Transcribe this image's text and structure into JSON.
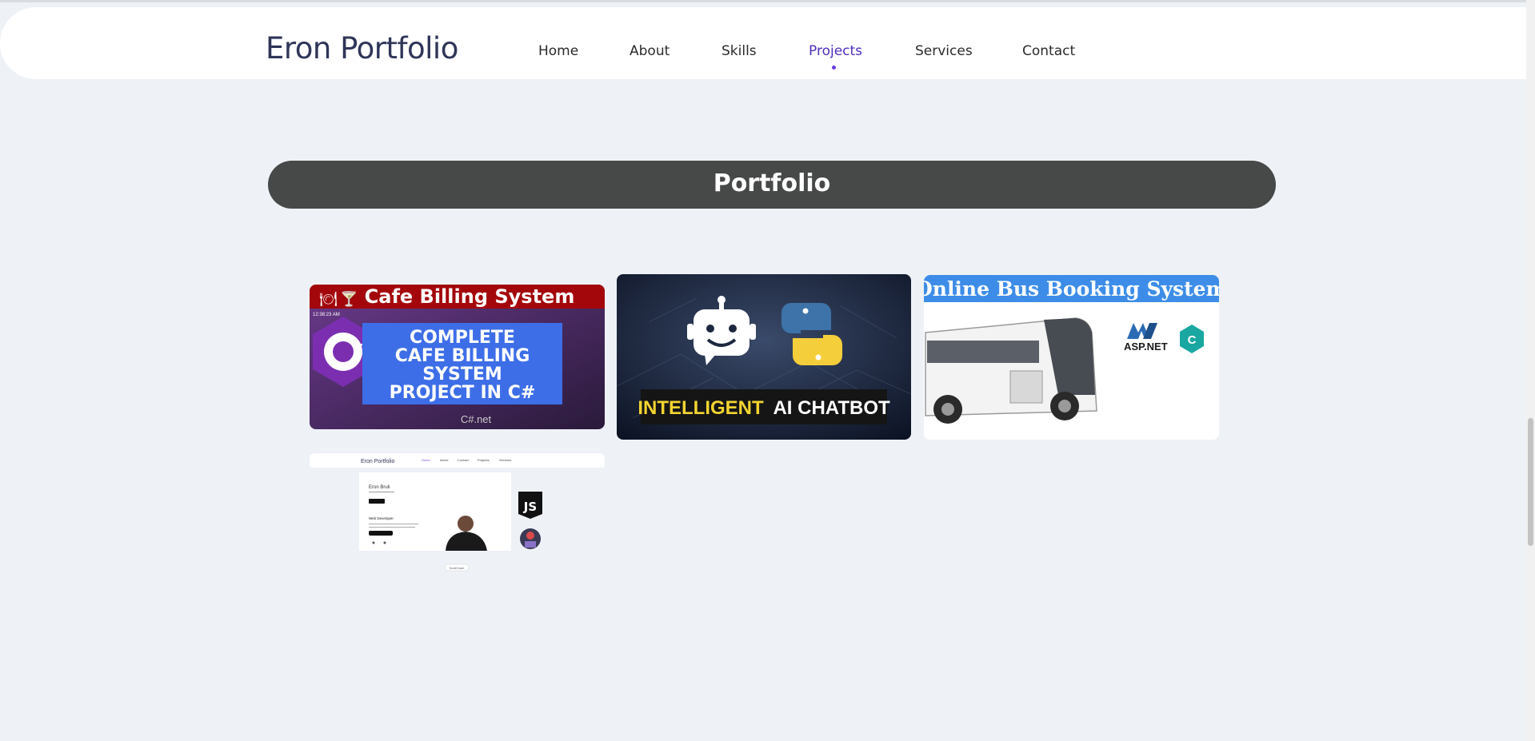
{
  "header": {
    "logo": "Eron Portfolio",
    "nav": [
      {
        "label": "Home"
      },
      {
        "label": "About"
      },
      {
        "label": "Skills"
      },
      {
        "label": "Projects",
        "active": true
      },
      {
        "label": "Services"
      },
      {
        "label": "Contact"
      }
    ],
    "active_color": "#4f2dbf"
  },
  "section": {
    "title": "Portfolio"
  },
  "projects": [
    {
      "name": "cafe-billing",
      "banner": "Cafe Billing System",
      "lines": [
        "COMPLETE",
        "CAFE BILLING",
        "SYSTEM",
        "PROJECT IN C#"
      ],
      "badge": "C#",
      "footer": "C#.net",
      "clock": "12:38:23 AM"
    },
    {
      "name": "ai-chatbot",
      "caption_highlight": "INTELLIGENT",
      "caption_rest": "AI CHATBOT"
    },
    {
      "name": "bus-booking",
      "banner": "Online Bus Booking System",
      "tech_label": "ASP.NET",
      "tech_badge": "C"
    },
    {
      "name": "portfolio-site",
      "mini_logo": "Eron Portfolio",
      "mini_nav": [
        "Home",
        "About",
        "Contact",
        "Projects",
        "Services"
      ],
      "mini_name": "Eron Bruli",
      "mini_role": "Web Developer",
      "badge": "JS",
      "scroll_hint": "Scroll Down"
    }
  ]
}
